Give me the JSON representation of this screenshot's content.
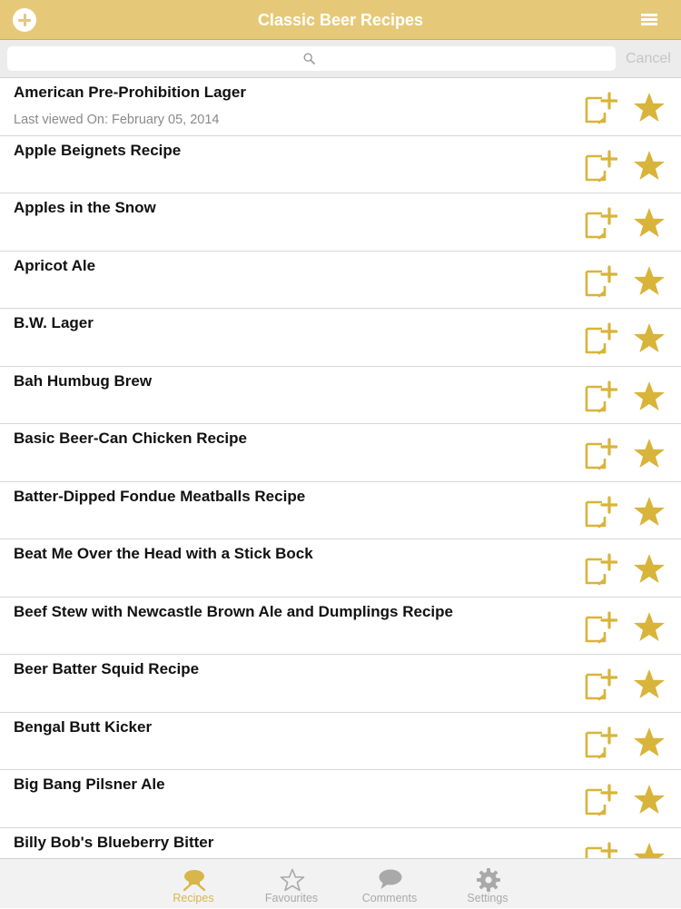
{
  "navbar": {
    "title": "Classic Beer Recipes"
  },
  "search": {
    "placeholder": "",
    "value": "",
    "cancel_label": "Cancel"
  },
  "recipes": [
    {
      "title": "American Pre-Prohibition Lager",
      "subtitle": "Last viewed On: February 05, 2014"
    },
    {
      "title": "Apple Beignets Recipe",
      "subtitle": ""
    },
    {
      "title": "Apples in the Snow",
      "subtitle": ""
    },
    {
      "title": "Apricot Ale",
      "subtitle": ""
    },
    {
      "title": "B.W. Lager",
      "subtitle": ""
    },
    {
      "title": "Bah Humbug Brew",
      "subtitle": ""
    },
    {
      "title": "Basic Beer-Can Chicken Recipe",
      "subtitle": ""
    },
    {
      "title": "Batter-Dipped Fondue Meatballs Recipe",
      "subtitle": ""
    },
    {
      "title": "Beat Me Over the Head with a Stick Bock",
      "subtitle": ""
    },
    {
      "title": "Beef Stew with Newcastle Brown Ale and Dumplings Recipe",
      "subtitle": ""
    },
    {
      "title": "Beer Batter Squid Recipe",
      "subtitle": ""
    },
    {
      "title": "Bengal Butt Kicker",
      "subtitle": ""
    },
    {
      "title": "Big Bang Pilsner Ale",
      "subtitle": ""
    },
    {
      "title": "Billy Bob's Blueberry Bitter",
      "subtitle": ""
    }
  ],
  "tabs": [
    {
      "label": "Recipes",
      "icon": "chef-hat-icon",
      "active": true
    },
    {
      "label": "Favourites",
      "icon": "star-outline-icon",
      "active": false
    },
    {
      "label": "Comments",
      "icon": "speech-bubble-icon",
      "active": false
    },
    {
      "label": "Settings",
      "icon": "gear-icon",
      "active": false
    }
  ],
  "colors": {
    "accent": "#e6c978",
    "icon_gold": "#d9b43a",
    "tab_inactive": "#a9a9a9"
  }
}
